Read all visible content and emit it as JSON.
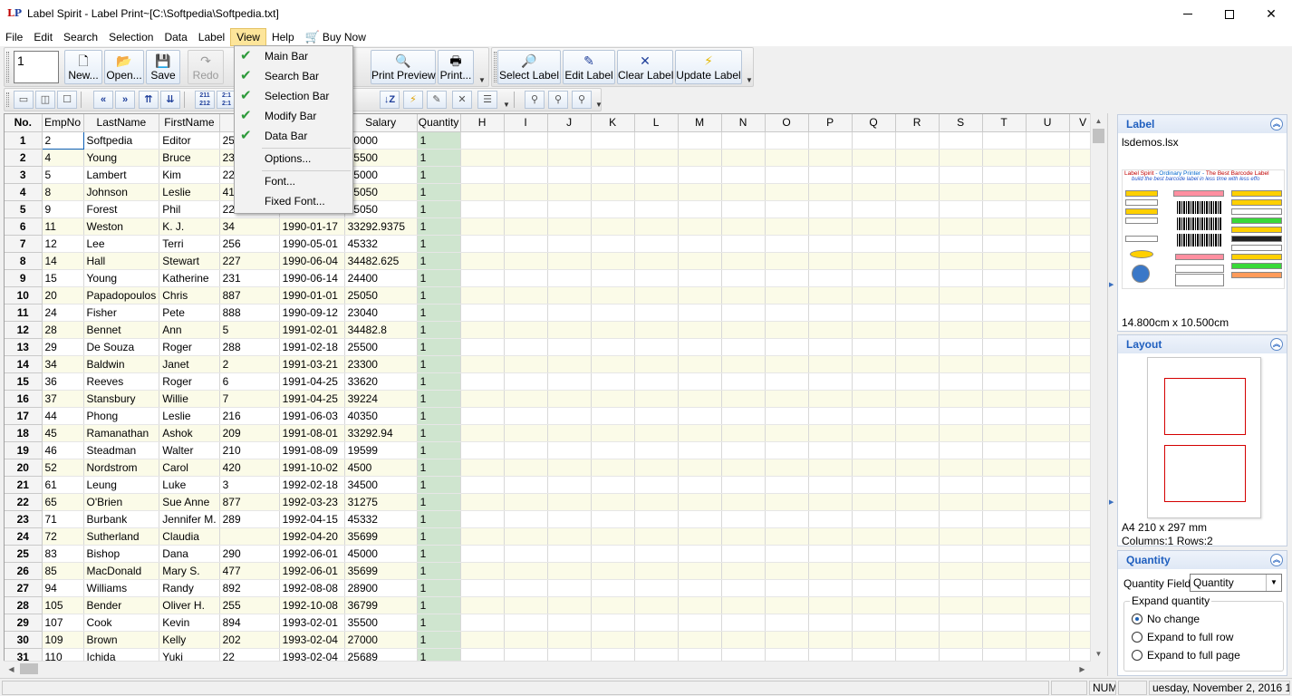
{
  "window": {
    "title": "Label Spirit - Label Print~[C:\\Softpedia\\Softpedia.txt]",
    "logo_l": "L",
    "logo_p": "P"
  },
  "menubar": {
    "items": [
      "File",
      "Edit",
      "Search",
      "Selection",
      "Data",
      "Label",
      "View",
      "Help",
      "Buy Now"
    ],
    "active": "View"
  },
  "toolbar_main": {
    "copies": "1",
    "new": "New...",
    "open": "Open...",
    "save": "Save",
    "redo": "Redo",
    "print_preview": "Print Preview",
    "print": "Print..."
  },
  "toolbar_label": {
    "select_label": "Select Label",
    "edit_label": "Edit Label",
    "clear_label": "Clear Label",
    "update_label": "Update Label"
  },
  "view_menu": {
    "items": [
      {
        "label": "Main Bar",
        "checked": true
      },
      {
        "label": "Search Bar",
        "checked": true
      },
      {
        "label": "Selection Bar",
        "checked": true
      },
      {
        "label": "Modify Bar",
        "checked": true
      },
      {
        "label": "Data Bar",
        "checked": true
      },
      {
        "label": "Options...",
        "checked": false
      },
      {
        "label": "Font...",
        "checked": false
      },
      {
        "label": "Fixed Font...",
        "checked": false
      }
    ]
  },
  "grid": {
    "columns": [
      "No.",
      "EmpNo",
      "LastName",
      "FirstName",
      "Ph",
      "",
      "Salary",
      "Quantity",
      "H",
      "I",
      "J",
      "K",
      "L",
      "M",
      "N",
      "O",
      "P",
      "Q",
      "R",
      "S",
      "T",
      "U",
      "V"
    ],
    "rows": [
      [
        "1",
        "2",
        "Softpedia",
        "Editor",
        "250",
        "",
        "40000",
        "1"
      ],
      [
        "2",
        "4",
        "Young",
        "Bruce",
        "233",
        "",
        "55500",
        "1"
      ],
      [
        "3",
        "5",
        "Lambert",
        "Kim",
        "22",
        "",
        "25000",
        "1"
      ],
      [
        "4",
        "8",
        "Johnson",
        "Leslie",
        "410",
        "",
        "25050",
        "1"
      ],
      [
        "5",
        "9",
        "Forest",
        "Phil",
        "229",
        "",
        "25050",
        "1"
      ],
      [
        "6",
        "11",
        "Weston",
        "K. J.",
        "34",
        "1990-01-17",
        "33292.9375",
        "1"
      ],
      [
        "7",
        "12",
        "Lee",
        "Terri",
        "256",
        "1990-05-01",
        "45332",
        "1"
      ],
      [
        "8",
        "14",
        "Hall",
        "Stewart",
        "227",
        "1990-06-04",
        "34482.625",
        "1"
      ],
      [
        "9",
        "15",
        "Young",
        "Katherine",
        "231",
        "1990-06-14",
        "24400",
        "1"
      ],
      [
        "10",
        "20",
        "Papadopoulos",
        "Chris",
        "887",
        "1990-01-01",
        "25050",
        "1"
      ],
      [
        "11",
        "24",
        "Fisher",
        "Pete",
        "888",
        "1990-09-12",
        "23040",
        "1"
      ],
      [
        "12",
        "28",
        "Bennet",
        "Ann",
        "5",
        "1991-02-01",
        "34482.8",
        "1"
      ],
      [
        "13",
        "29",
        "De Souza",
        "Roger",
        "288",
        "1991-02-18",
        "25500",
        "1"
      ],
      [
        "14",
        "34",
        "Baldwin",
        "Janet",
        "2",
        "1991-03-21",
        "23300",
        "1"
      ],
      [
        "15",
        "36",
        "Reeves",
        "Roger",
        "6",
        "1991-04-25",
        "33620",
        "1"
      ],
      [
        "16",
        "37",
        "Stansbury",
        "Willie",
        "7",
        "1991-04-25",
        "39224",
        "1"
      ],
      [
        "17",
        "44",
        "Phong",
        "Leslie",
        "216",
        "1991-06-03",
        "40350",
        "1"
      ],
      [
        "18",
        "45",
        "Ramanathan",
        "Ashok",
        "209",
        "1991-08-01",
        "33292.94",
        "1"
      ],
      [
        "19",
        "46",
        "Steadman",
        "Walter",
        "210",
        "1991-08-09",
        "19599",
        "1"
      ],
      [
        "20",
        "52",
        "Nordstrom",
        "Carol",
        "420",
        "1991-10-02",
        "4500",
        "1"
      ],
      [
        "21",
        "61",
        "Leung",
        "Luke",
        "3",
        "1992-02-18",
        "34500",
        "1"
      ],
      [
        "22",
        "65",
        "O'Brien",
        "Sue Anne",
        "877",
        "1992-03-23",
        "31275",
        "1"
      ],
      [
        "23",
        "71",
        "Burbank",
        "Jennifer M.",
        "289",
        "1992-04-15",
        "45332",
        "1"
      ],
      [
        "24",
        "72",
        "Sutherland",
        "Claudia",
        "",
        "1992-04-20",
        "35699",
        "1"
      ],
      [
        "25",
        "83",
        "Bishop",
        "Dana",
        "290",
        "1992-06-01",
        "45000",
        "1"
      ],
      [
        "26",
        "85",
        "MacDonald",
        "Mary S.",
        "477",
        "1992-06-01",
        "35699",
        "1"
      ],
      [
        "27",
        "94",
        "Williams",
        "Randy",
        "892",
        "1992-08-08",
        "28900",
        "1"
      ],
      [
        "28",
        "105",
        "Bender",
        "Oliver H.",
        "255",
        "1992-10-08",
        "36799",
        "1"
      ],
      [
        "29",
        "107",
        "Cook",
        "Kevin",
        "894",
        "1993-02-01",
        "35500",
        "1"
      ],
      [
        "30",
        "109",
        "Brown",
        "Kelly",
        "202",
        "1993-02-04",
        "27000",
        "1"
      ],
      [
        "31",
        "110",
        "Ichida",
        "Yuki",
        "22",
        "1993-02-04",
        "25689",
        "1"
      ]
    ]
  },
  "panels": {
    "label": {
      "title": "Label",
      "file": "lsdemos.lsx",
      "preview_title_a": "Label Spirit",
      "preview_title_b": " - Ordinary Printer - ",
      "preview_title_c": "The Best Barcode Label",
      "preview_subtitle": "build the best barcode label in less time with less effo",
      "size": "14.800cm x 10.500cm"
    },
    "layout": {
      "title": "Layout",
      "paper": "A4 210 x 297 mm",
      "grid": "Columns:1 Rows:2"
    },
    "quantity": {
      "title": "Quantity",
      "field_label": "Quantity Field:",
      "field_value": "Quantity",
      "group_label": "Expand quantity",
      "options": [
        "No change",
        "Expand to full row",
        "Expand to full page"
      ],
      "selected": "No change"
    }
  },
  "statusbar": {
    "num": "NUM",
    "datetime": "uesday, November 2, 2016 10:"
  },
  "colors": {
    "accent": "#1f5fbf",
    "menu_highlight": "#fde59a",
    "quantity_cell": "#cfe5cf",
    "row_stripe": "#fbfbe8",
    "check": "#2e9a3b"
  }
}
